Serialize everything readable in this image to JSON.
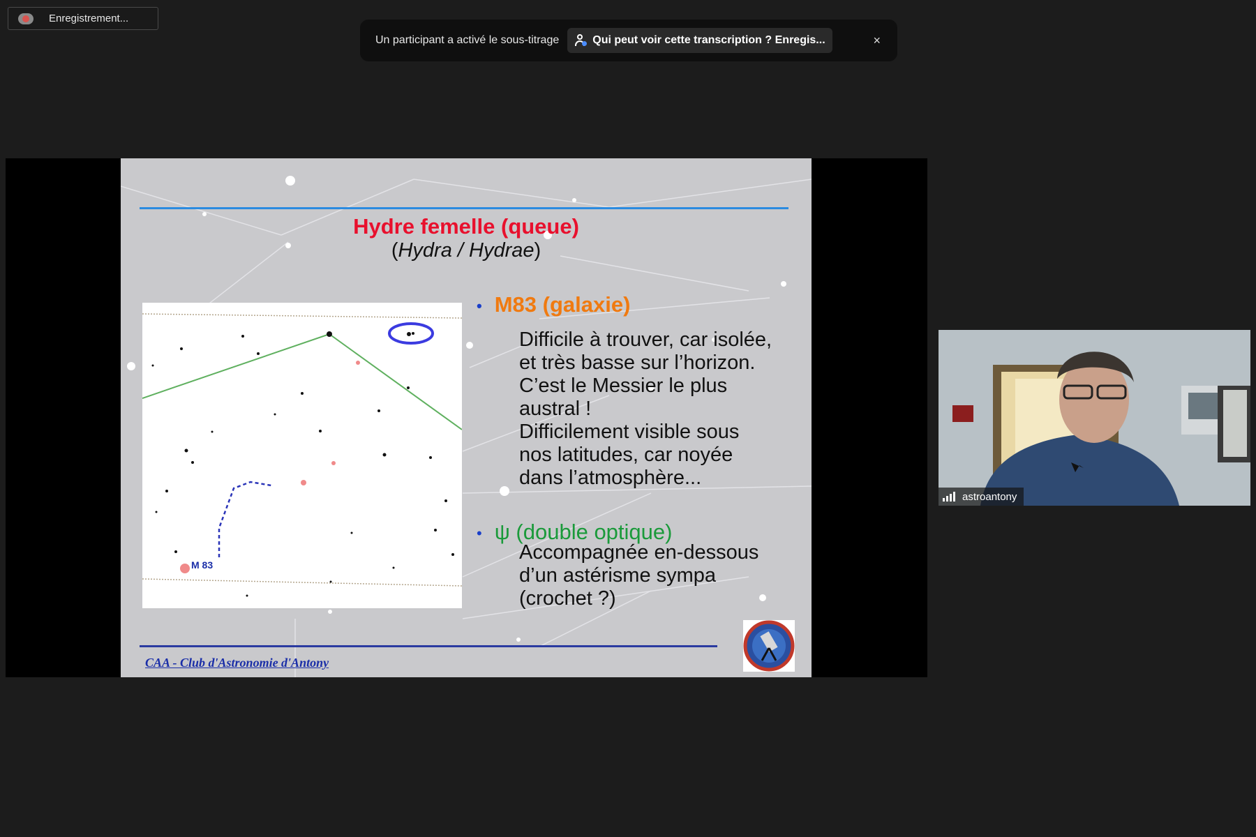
{
  "recording": {
    "label": "Enregistrement...",
    "icon": "cloud-recording-icon"
  },
  "captions": {
    "notice": "Un participant a activé le sous-titrage",
    "who_can_see": "Qui peut voir cette transcription ? Enregis...",
    "close_label": "×"
  },
  "slide": {
    "title": "Hydre femelle (queue)",
    "subtitle_open": "(",
    "subtitle_latin": "Hydra / Hydrae",
    "subtitle_close": ")",
    "map_label": "M 83",
    "bullet1_title": "M83 (galaxie)",
    "bullet1_lines": [
      "Difficile à trouver, car isolée,",
      "et très basse sur l’horizon.",
      "C’est le Messier le plus",
      "austral !",
      "Difficilement visible sous",
      "nos latitudes, car noyée",
      "dans l’atmosphère..."
    ],
    "bullet2_title": "ψ (double optique)",
    "bullet2_lines": [
      "Accompagnée en-dessous",
      "d’un astérisme sympa",
      "(crochet ?)"
    ],
    "footer": "CAA - Club d'Astronomie d'Antony",
    "colors": {
      "title": "#e8102d",
      "bullet1": "#f07a10",
      "bullet2": "#1a9a3a",
      "rule_top": "#2b8be0",
      "rule_bottom": "#2a3aa0"
    }
  },
  "participant": {
    "name": "astroantony",
    "icon": "signal-strength-icon"
  }
}
